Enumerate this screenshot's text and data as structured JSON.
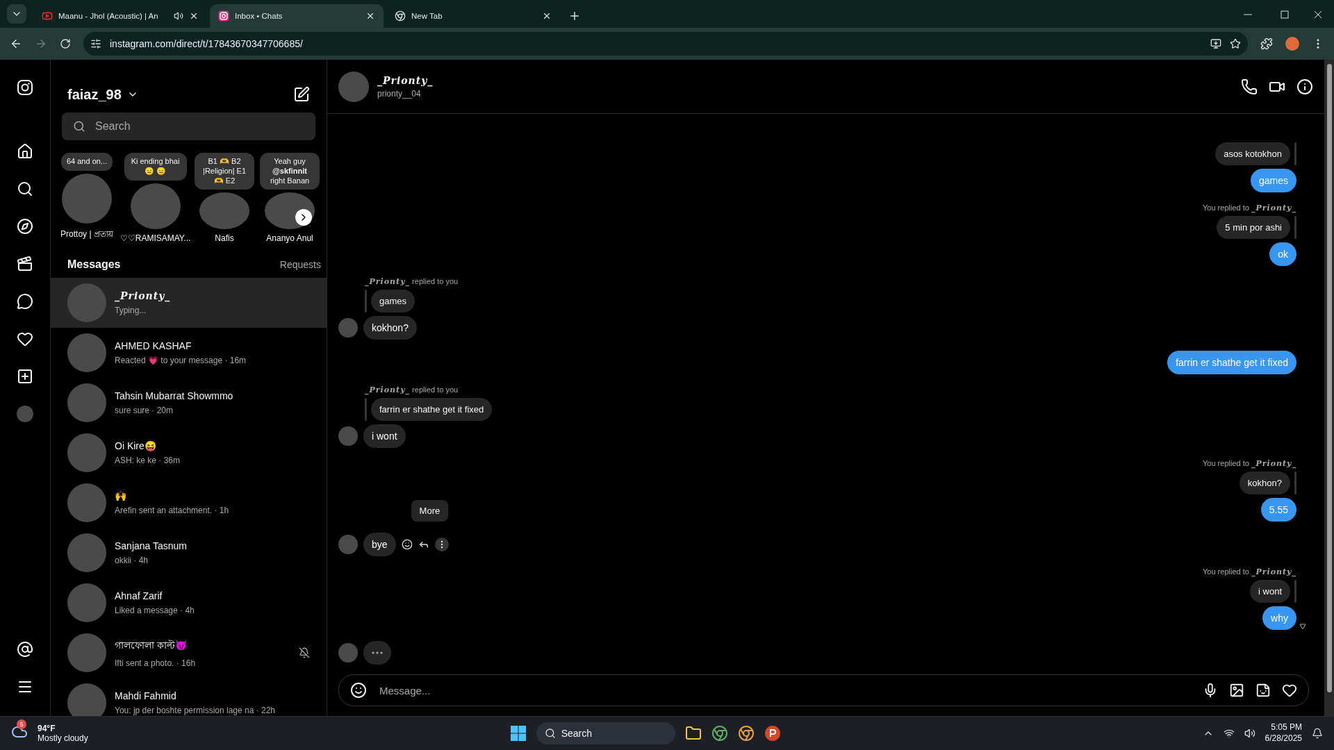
{
  "browser": {
    "tabs": [
      {
        "title": "Maanu - Jhol (Acoustic) | An",
        "kind": "youtube",
        "audio": true,
        "selected": false
      },
      {
        "title": "Inbox • Chats",
        "kind": "instagram",
        "audio": false,
        "selected": true
      },
      {
        "title": "New Tab",
        "kind": "chrome",
        "audio": false,
        "selected": false
      }
    ],
    "url": "instagram.com/direct/t/17843670347706685/"
  },
  "nav": [
    {
      "kind": "home"
    },
    {
      "kind": "search"
    },
    {
      "kind": "explore"
    },
    {
      "kind": "reels"
    },
    {
      "kind": "messages"
    },
    {
      "kind": "notifications"
    },
    {
      "kind": "create"
    },
    {
      "kind": "profile"
    }
  ],
  "inbox": {
    "username": "faiaz_98",
    "search": {
      "placeholder": "Search"
    },
    "notes": [
      {
        "note": "64 and on...",
        "name": "Prottoy | প্রত্যয়"
      },
      {
        "note": "Ki ending bhai 😑 😑",
        "name": "♡♡RAMISAMAY..."
      },
      {
        "note": "B1 🫶 B2 |Religion| E1 🫶 E2",
        "name": "Nafis"
      },
      {
        "note": "Yeah guy **@skfinnit** right Banan",
        "name": "Ananyo Anul"
      }
    ],
    "messages_title": "Messages",
    "requests_label": "Requests",
    "threads": [
      {
        "name": "_Prionty_",
        "preview": "Typing...",
        "selected": true,
        "muted": false,
        "script": true
      },
      {
        "name": "AHMED KASHAF",
        "preview": "Reacted 💗 to your message · 16m",
        "selected": false,
        "muted": false,
        "script": false
      },
      {
        "name": "Tahsin Mubarrat Showmmo",
        "preview": "sure sure · 20m",
        "selected": false,
        "muted": false,
        "script": false
      },
      {
        "name": "Oi Kire😝",
        "preview": "ASH: ke ke · 36m",
        "selected": false,
        "muted": false,
        "script": false
      },
      {
        "name": "🙌",
        "preview": "Arefin sent an attachment. · 1h",
        "selected": false,
        "muted": false,
        "script": false
      },
      {
        "name": "Sanjana Tasnum",
        "preview": "okkii · 4h",
        "selected": false,
        "muted": false,
        "script": false
      },
      {
        "name": "Ahnaf Zarif",
        "preview": "Liked a message · 4h",
        "selected": false,
        "muted": false,
        "script": false
      },
      {
        "name": "গালফোলা কাল্ট😈",
        "preview": "Ifti sent a photo. · 16h",
        "selected": false,
        "muted": true,
        "script": false
      },
      {
        "name": "Mahdi Fahmid",
        "preview": "You: jp der boshte permission lage na · 22h",
        "selected": false,
        "muted": false,
        "script": false
      }
    ]
  },
  "chat": {
    "name": "_Prionty_",
    "handle": "prionty__04",
    "groups": [
      {
        "outgoing": true,
        "quoted": "asos kotokhon",
        "text": "games"
      },
      {
        "outgoing": true,
        "reply": {
          "prefix": "You replied to ",
          "name": "_Prionty_"
        },
        "quoted": "5 min por ashi",
        "text": "ok"
      },
      {
        "outgoing": false,
        "reply": {
          "name": "_Prionty_",
          "suffix": " replied to you"
        },
        "quoted": "games",
        "text": "kokhon?"
      },
      {
        "outgoing": true,
        "text": "farrin er shathe get it fixed"
      },
      {
        "outgoing": false,
        "reply": {
          "name": "_Prionty_",
          "suffix": " replied to you"
        },
        "quoted": "farrin er shathe get it fixed",
        "text": "i wont"
      },
      {
        "outgoing": true,
        "reply": {
          "prefix": "You replied to ",
          "name": "_Prionty_"
        },
        "quoted": "kokhon?",
        "text": "5.55"
      },
      {
        "outgoing": false,
        "text": "bye",
        "tooltip": "More"
      },
      {
        "outgoing": true,
        "reply": {
          "prefix": "You replied to ",
          "name": "_Prionty_"
        },
        "quoted": "i wont",
        "text": "why",
        "seen": true
      },
      {
        "outgoing": false,
        "typing": true
      }
    ],
    "composer": {
      "placeholder": "Message..."
    }
  },
  "taskbar": {
    "badge": "5",
    "temperature": "94°F",
    "weather": "Mostly cloudy",
    "search": "Search",
    "time": "5:05 PM",
    "date": "6/28/2025"
  }
}
